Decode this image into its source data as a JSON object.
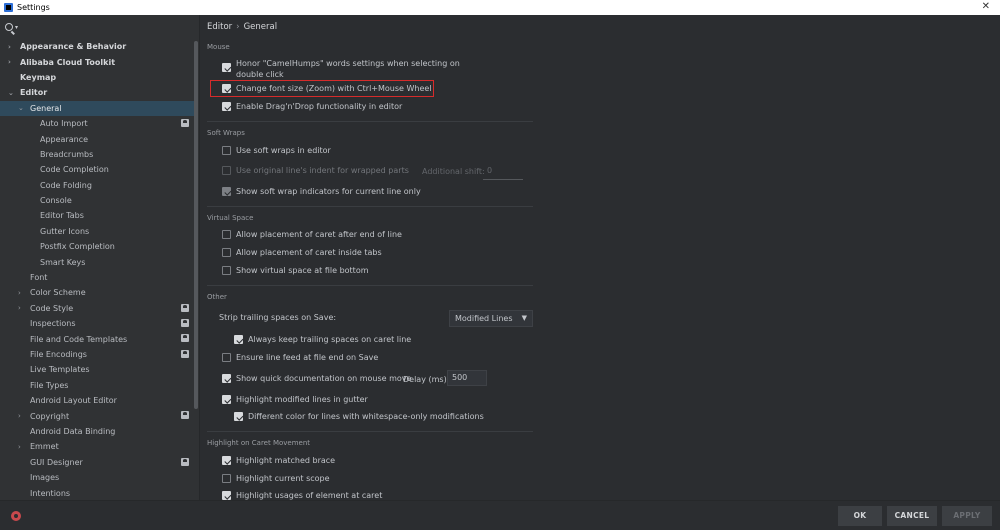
{
  "window": {
    "title": "Settings",
    "close_glyph": "✕"
  },
  "search": {
    "icon": "search-icon"
  },
  "sidebar": {
    "items": [
      {
        "label": "Appearance & Behavior",
        "level": 0,
        "arrow": "›",
        "bold": true
      },
      {
        "label": "Alibaba Cloud Toolkit",
        "level": 0,
        "arrow": "›",
        "bold": true
      },
      {
        "label": "Keymap",
        "level": 0,
        "arrow": "",
        "bold": true
      },
      {
        "label": "Editor",
        "level": 0,
        "arrow": "⌄",
        "bold": true
      },
      {
        "label": "General",
        "level": 1,
        "arrow": "⌄",
        "selected": true
      },
      {
        "label": "Auto Import",
        "level": 2,
        "badge": true
      },
      {
        "label": "Appearance",
        "level": 2
      },
      {
        "label": "Breadcrumbs",
        "level": 2
      },
      {
        "label": "Code Completion",
        "level": 2
      },
      {
        "label": "Code Folding",
        "level": 2
      },
      {
        "label": "Console",
        "level": 2
      },
      {
        "label": "Editor Tabs",
        "level": 2
      },
      {
        "label": "Gutter Icons",
        "level": 2
      },
      {
        "label": "Postfix Completion",
        "level": 2
      },
      {
        "label": "Smart Keys",
        "level": 2
      },
      {
        "label": "Font",
        "level": 1
      },
      {
        "label": "Color Scheme",
        "level": 1,
        "arrow": "›"
      },
      {
        "label": "Code Style",
        "level": 1,
        "arrow": "›",
        "badge": true
      },
      {
        "label": "Inspections",
        "level": 1,
        "badge": true
      },
      {
        "label": "File and Code Templates",
        "level": 1,
        "badge": true
      },
      {
        "label": "File Encodings",
        "level": 1,
        "badge": true
      },
      {
        "label": "Live Templates",
        "level": 1
      },
      {
        "label": "File Types",
        "level": 1
      },
      {
        "label": "Android Layout Editor",
        "level": 1
      },
      {
        "label": "Copyright",
        "level": 1,
        "arrow": "›",
        "badge": true
      },
      {
        "label": "Android Data Binding",
        "level": 1
      },
      {
        "label": "Emmet",
        "level": 1,
        "arrow": "›"
      },
      {
        "label": "GUI Designer",
        "level": 1,
        "badge": true
      },
      {
        "label": "Images",
        "level": 1
      },
      {
        "label": "Intentions",
        "level": 1
      }
    ]
  },
  "breadcrumb": {
    "parent": "Editor",
    "separator": "›",
    "current": "General"
  },
  "sections": {
    "mouse": "Mouse",
    "soft_wraps": "Soft Wraps",
    "virtual_space": "Virtual Space",
    "other": "Other",
    "highlight_caret": "Highlight on Caret Movement"
  },
  "options": {
    "camel_humps_1": "Honor \"CamelHumps\" words settings when selecting on",
    "camel_humps_2": "double click",
    "change_font_size": "Change font size (Zoom) with Ctrl+Mouse Wheel",
    "drag_drop": "Enable Drag'n'Drop functionality in editor",
    "soft_wraps": "Use soft wraps in editor",
    "original_indent": "Use original line's indent for wrapped parts",
    "additional_shift_label": "Additional shift:",
    "additional_shift_value": "0",
    "soft_wrap_indicators": "Show soft wrap indicators for current line only",
    "caret_after_eol": "Allow placement of caret after end of line",
    "caret_inside_tabs": "Allow placement of caret inside tabs",
    "virtual_space_bottom": "Show virtual space at file bottom",
    "strip_trailing_label": "Strip trailing spaces on Save:",
    "strip_trailing_value": "Modified Lines",
    "keep_trailing_caret": "Always keep trailing spaces on caret line",
    "ensure_line_feed": "Ensure line feed at file end on Save",
    "quick_doc": "Show quick documentation on mouse move",
    "delay_label": "Delay (ms):",
    "delay_value": "500",
    "highlight_modified": "Highlight modified lines in gutter",
    "different_color": "Different color for lines with whitespace-only modifications",
    "matched_brace": "Highlight matched brace",
    "current_scope": "Highlight current scope",
    "usages_at_caret": "Highlight usages of element at caret"
  },
  "checks": {
    "camel_humps": true,
    "change_font_size": true,
    "drag_drop": true,
    "soft_wraps": false,
    "original_indent": false,
    "soft_wrap_indicators": true,
    "caret_after_eol": false,
    "caret_inside_tabs": false,
    "virtual_space_bottom": false,
    "keep_trailing_caret": true,
    "ensure_line_feed": false,
    "quick_doc": true,
    "highlight_modified": true,
    "different_color": true,
    "matched_brace": true,
    "current_scope": false,
    "usages_at_caret": true
  },
  "footer": {
    "ok": "OK",
    "cancel": "CANCEL",
    "apply": "APPLY"
  },
  "colors": {
    "highlight_box": "#d62b2b",
    "selection": "#2f4a5c",
    "help_icon": "#c9494d"
  }
}
